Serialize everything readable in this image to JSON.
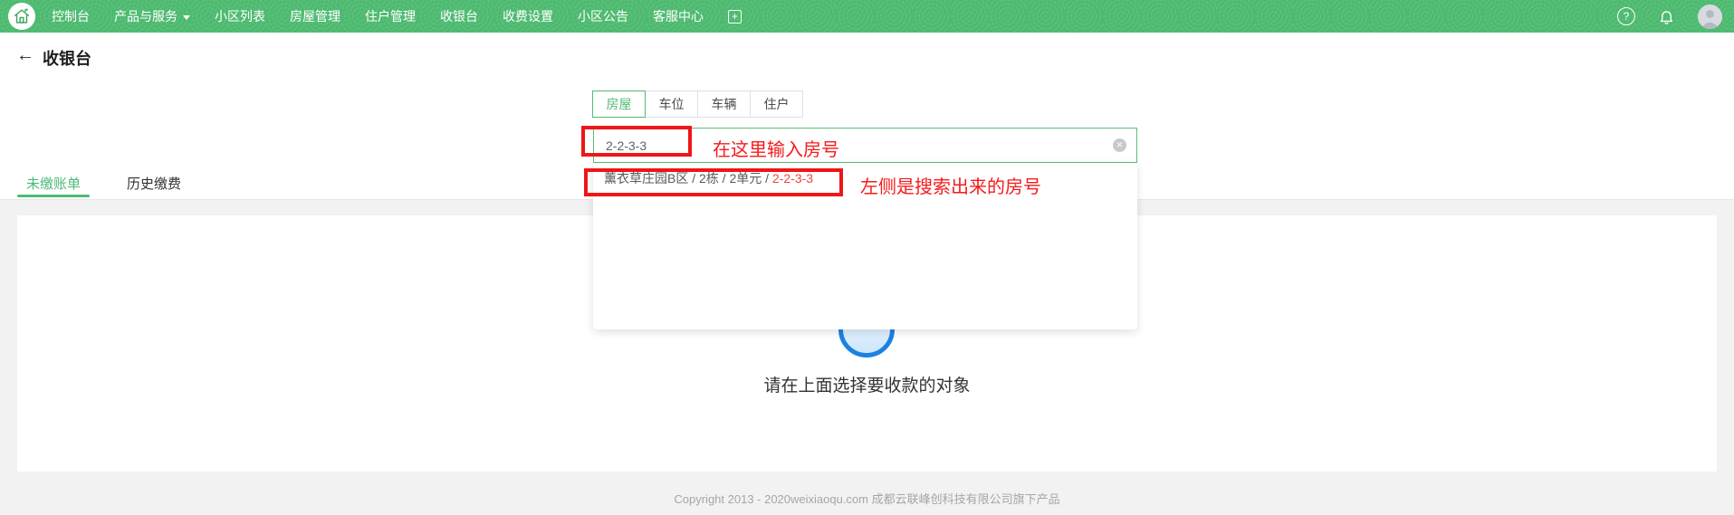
{
  "nav": {
    "items": [
      "控制台",
      "产品与服务",
      "小区列表",
      "房屋管理",
      "住户管理",
      "收银台",
      "收费设置",
      "小区公告",
      "客服中心"
    ]
  },
  "icons": {
    "help_glyph": "?",
    "plus_glyph": "+",
    "clear_glyph": "✕",
    "back_glyph": "←"
  },
  "header": {
    "title": "收银台"
  },
  "object_selector": {
    "type_tabs": [
      "房屋",
      "车位",
      "车辆",
      "住户"
    ],
    "active_type": "房屋",
    "search_value": "2-2-3-3",
    "result": {
      "prefix": "薰衣草庄园B区 / 2栋 / 2单元 / ",
      "match": "2-2-3-3"
    }
  },
  "annotations": {
    "input_hint": "在这里输入房号",
    "result_hint": "左侧是搜索出来的房号"
  },
  "billing_tabs": {
    "items": [
      "未缴账单",
      "历史缴费"
    ],
    "active": "未缴账单"
  },
  "empty_state": {
    "message": "请在上面选择要收款的对象"
  },
  "footer": {
    "copyright": "Copyright 2013 - 2020weixiaoqu.com 成都云联峰创科技有限公司旗下产品"
  },
  "colors": {
    "brand_green": "#4CB96F",
    "active_green": "#53B874",
    "input_border_green": "#5ABD7C",
    "annotation_red": "#F51A1A",
    "match_red": "#F4433C",
    "circle_blue": "#1B82E2",
    "bg_gray": "#F2F2F2"
  }
}
